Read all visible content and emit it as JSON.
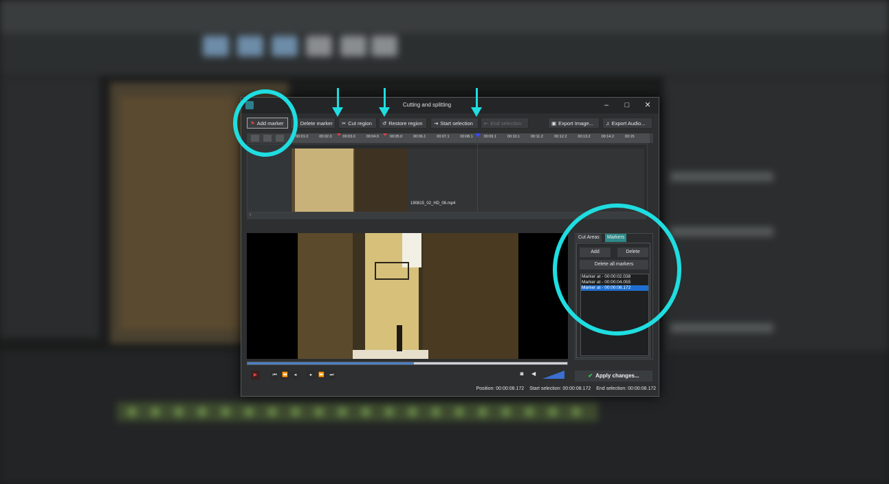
{
  "dialog": {
    "title": "Cutting and splitting",
    "window_controls": {
      "minimize": "–",
      "maximize": "□",
      "close": "✕"
    }
  },
  "toolbar": {
    "add_marker": "Add marker",
    "delete_marker": "Delete marker",
    "cut_region": "Cut region",
    "restore_region": "Restore region",
    "start_selection": "Start selection",
    "end_selection": "End selection",
    "export_image": "Export Image...",
    "export_audio": "Export Audio..."
  },
  "ruler": {
    "ticks": [
      "00:01.0",
      "00:02.0",
      "00:03.0",
      "00:04.0",
      "00:05.0",
      "00:06.1",
      "00:07.1",
      "00:08.1",
      "00:09.1",
      "00:10.1",
      "00:11.2",
      "00:12.2",
      "00:13.2",
      "00:14.2",
      "00:15"
    ]
  },
  "timeline": {
    "clip_name": "190815_02_HD_06.mp4"
  },
  "player": {
    "progress": 0.52,
    "volume_icon": "speaker-icon",
    "snapshot_icon": "camera-icon"
  },
  "side_panel": {
    "tabs": [
      "Cut Areas",
      "Markers"
    ],
    "active_tab": "Markers",
    "add": "Add",
    "delete": "Delete",
    "delete_all": "Delete all markers",
    "markers": [
      "Marker at - 00:00:02.038",
      "Marker at - 00:00:04.055",
      "Marker at - 00:00:08.172"
    ],
    "selected_marker": 2
  },
  "apply": "Apply changes...",
  "status": {
    "position": "Position: 00:00:08.172",
    "start_selection": "Start selection: 00:00:08.172",
    "end_selection": "End selection: 00:00:08.172"
  },
  "colors": {
    "highlight": "#1fdde0",
    "accent_tab": "#2d8a88",
    "selection": "#1e6fd0"
  }
}
